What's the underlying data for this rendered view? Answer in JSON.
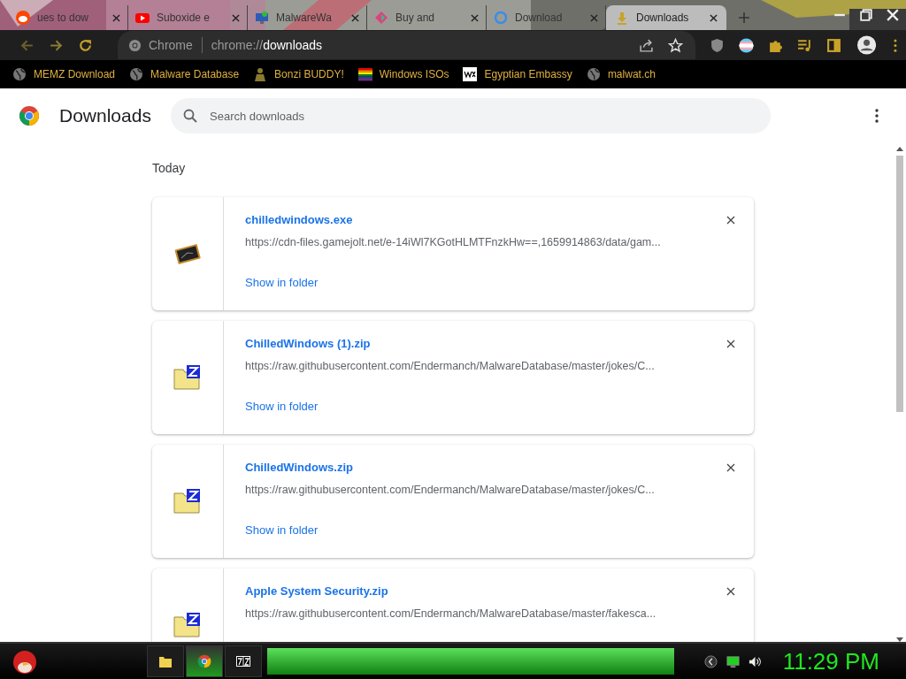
{
  "tabs": [
    {
      "title": "ues to dow",
      "kind": "reddit",
      "selected": false
    },
    {
      "title": "Suboxide e",
      "kind": "video",
      "selected": false
    },
    {
      "title": "MalwareWa",
      "kind": "computer",
      "selected": false
    },
    {
      "title": "Buy and",
      "kind": "diamond",
      "selected": false
    },
    {
      "title": "Download",
      "kind": "loader",
      "selected": false
    },
    {
      "title": "Downloads",
      "kind": "download",
      "selected": true
    }
  ],
  "toolbar": {
    "origin": "Chrome",
    "url_prefix": "chrome://",
    "url_path": "downloads"
  },
  "bookmarks": [
    {
      "label": "MEMZ Download",
      "kind": "globe"
    },
    {
      "label": "Malware Database",
      "kind": "globe"
    },
    {
      "label": "Bonzi BUDDY!",
      "kind": "figure"
    },
    {
      "label": "Windows ISOs",
      "kind": "rainbow"
    },
    {
      "label": "Egyptian Embassy",
      "kind": "square"
    },
    {
      "label": "malwat.ch",
      "kind": "globe"
    }
  ],
  "page": {
    "title": "Downloads",
    "search": {
      "placeholder": "Search downloads"
    },
    "section": "Today",
    "downloads": [
      {
        "name": "chilledwindows.exe",
        "url": "https://cdn-files.gamejolt.net/e-14iWl7KGotHLMTFnzkHw==,1659914863/data/gam...",
        "action": "Show in folder",
        "kind": "exe"
      },
      {
        "name": "ChilledWindows (1).zip",
        "url": "https://raw.githubusercontent.com/Endermanch/MalwareDatabase/master/jokes/C...",
        "action": "Show in folder",
        "kind": "zip"
      },
      {
        "name": "ChilledWindows.zip",
        "url": "https://raw.githubusercontent.com/Endermanch/MalwareDatabase/master/jokes/C...",
        "action": "Show in folder",
        "kind": "zip"
      },
      {
        "name": "Apple System Security.zip",
        "url": "https://raw.githubusercontent.com/Endermanch/MalwareDatabase/master/fakesca...",
        "kind": "zip"
      }
    ]
  },
  "taskbar": {
    "apps": [
      {
        "kind": "folder",
        "selected": false
      },
      {
        "kind": "chrome",
        "selected": true
      },
      {
        "kind": "archive",
        "selected": false
      }
    ],
    "clock": "11:29 PM"
  }
}
